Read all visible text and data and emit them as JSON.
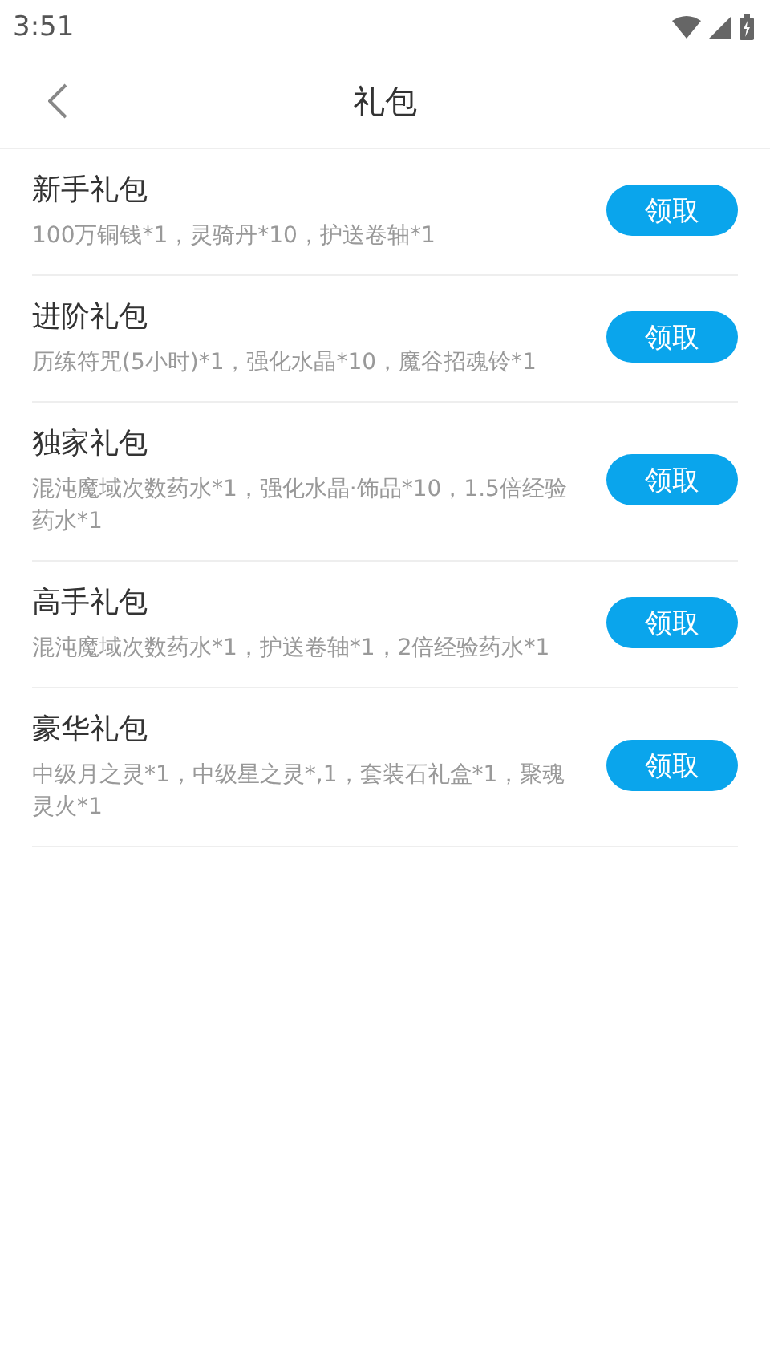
{
  "status_bar": {
    "time": "3:51"
  },
  "header": {
    "title": "礼包"
  },
  "gifts": [
    {
      "name": "新手礼包",
      "contents": "100万铜钱*1，灵骑丹*10，护送卷轴*1",
      "button": "领取"
    },
    {
      "name": "进阶礼包",
      "contents": "历练符咒(5小时)*1，强化水晶*10，魔谷招魂铃*1",
      "button": "领取"
    },
    {
      "name": "独家礼包",
      "contents": "混沌魔域次数药水*1，强化水晶·饰品*10，1.5倍经验药水*1",
      "button": "领取"
    },
    {
      "name": "高手礼包",
      "contents": "混沌魔域次数药水*1，护送卷轴*1，2倍经验药水*1",
      "button": "领取"
    },
    {
      "name": "豪华礼包",
      "contents": "中级月之灵*1，中级星之灵*,1，套装石礼盒*1，聚魂灵火*1",
      "button": "领取"
    }
  ]
}
